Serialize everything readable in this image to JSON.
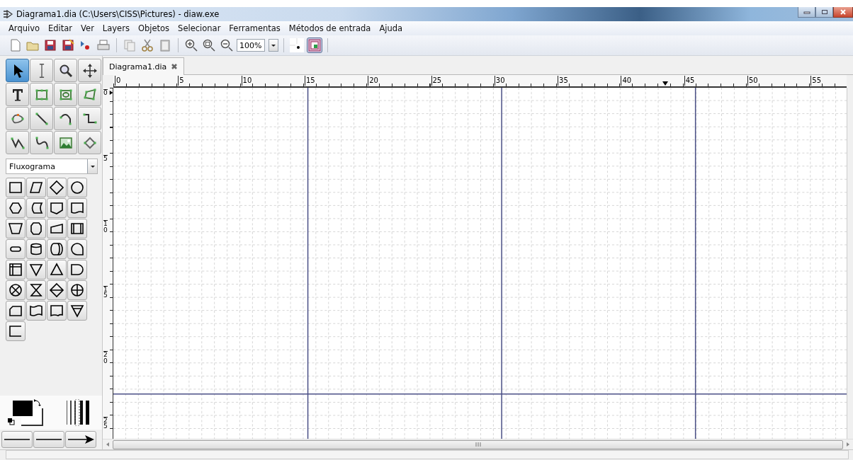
{
  "window": {
    "title": "Diagrama1.dia (C:\\Users\\CISS\\Pictures) - diaw.exe"
  },
  "menu": [
    {
      "label": "Arquivo"
    },
    {
      "label": "Editar"
    },
    {
      "label": "Ver"
    },
    {
      "label": "Layers"
    },
    {
      "label": "Objetos"
    },
    {
      "label": "Selecionar"
    },
    {
      "label": "Ferramentas"
    },
    {
      "label": "Métodos de entrada"
    },
    {
      "label": "Ajuda"
    }
  ],
  "toolbar": {
    "zoom": "100%",
    "object_snap": true
  },
  "tools": [
    {
      "kind": "pointer",
      "selected": true
    },
    {
      "kind": "text-cursor",
      "selected": false
    },
    {
      "kind": "magnifier",
      "selected": false
    },
    {
      "kind": "move",
      "selected": false
    },
    {
      "kind": "text",
      "selected": false
    },
    {
      "kind": "box",
      "selected": false
    },
    {
      "kind": "ellipse",
      "selected": false
    },
    {
      "kind": "polygon",
      "selected": false
    },
    {
      "kind": "beziergon",
      "selected": false
    },
    {
      "kind": "line",
      "selected": false
    },
    {
      "kind": "arc",
      "selected": false
    },
    {
      "kind": "zigzag",
      "selected": false
    },
    {
      "kind": "polyline",
      "selected": false
    },
    {
      "kind": "bezier",
      "selected": false
    },
    {
      "kind": "image",
      "selected": false
    },
    {
      "kind": "outline",
      "selected": false
    }
  ],
  "sheet_selector": {
    "value": "Fluxograma"
  },
  "shapes": [
    {
      "kind": "rectangle"
    },
    {
      "kind": "parallelogram"
    },
    {
      "kind": "diamond"
    },
    {
      "kind": "circle"
    },
    {
      "kind": "hexagon"
    },
    {
      "kind": "stored-data"
    },
    {
      "kind": "pentagon"
    },
    {
      "kind": "document"
    },
    {
      "kind": "trapezoid"
    },
    {
      "kind": "octagon"
    },
    {
      "kind": "manual-input"
    },
    {
      "kind": "predefined"
    },
    {
      "kind": "terminal"
    },
    {
      "kind": "cylinder"
    },
    {
      "kind": "drum"
    },
    {
      "kind": "tape"
    },
    {
      "kind": "internal-storage"
    },
    {
      "kind": "triangle-down"
    },
    {
      "kind": "triangle-up"
    },
    {
      "kind": "delay"
    },
    {
      "kind": "cross-circle"
    },
    {
      "kind": "hourglass"
    },
    {
      "kind": "split-diamond"
    },
    {
      "kind": "plus-circle"
    },
    {
      "kind": "card"
    },
    {
      "kind": "punched-tape"
    },
    {
      "kind": "wavy-box"
    },
    {
      "kind": "triangle-line"
    },
    {
      "kind": "open-box"
    }
  ],
  "tabs": [
    {
      "label": "Diagrama1.dia",
      "selected": true
    }
  ],
  "rulers": {
    "horizontal": [
      "0",
      "5",
      "10",
      "15",
      "20",
      "25",
      "30",
      "35",
      "40",
      "45",
      "50",
      "55"
    ],
    "vertical": [
      "0",
      "5",
      "10",
      "15",
      "20",
      "25"
    ]
  }
}
